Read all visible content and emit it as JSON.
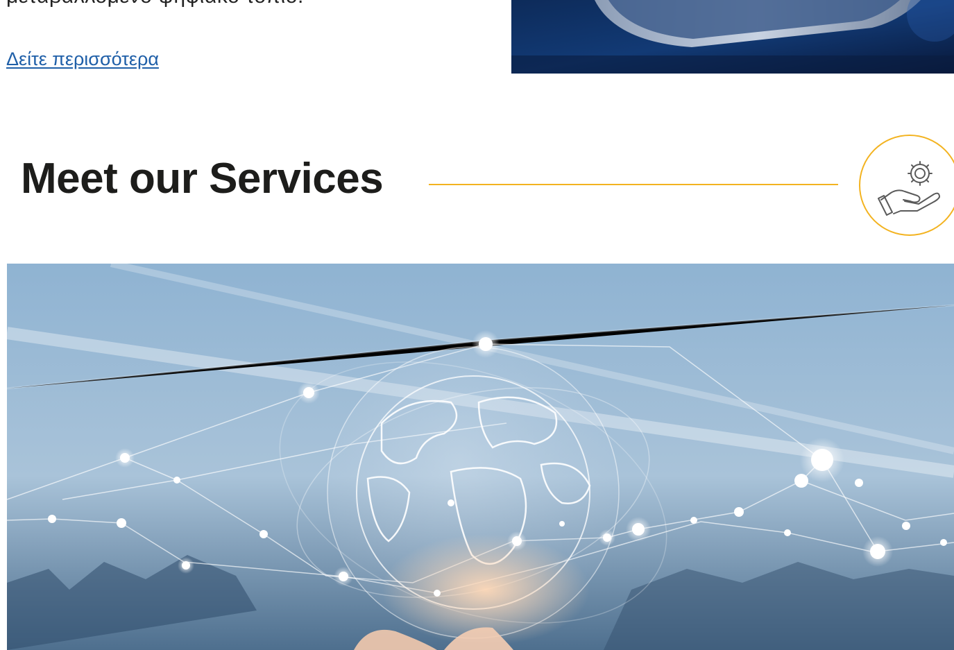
{
  "intro": {
    "text": "μεταβαλλόμενο ψηφιακό τοπίο.",
    "read_more": "Δείτε περισσότερα"
  },
  "services": {
    "title": "Meet our Services",
    "icon": "hand-gear-icon",
    "accent_color": "#f3b320"
  },
  "colors": {
    "title": "#1d1d1b",
    "link": "#1f5fa8",
    "banner_sky": "#7ea6c8"
  }
}
